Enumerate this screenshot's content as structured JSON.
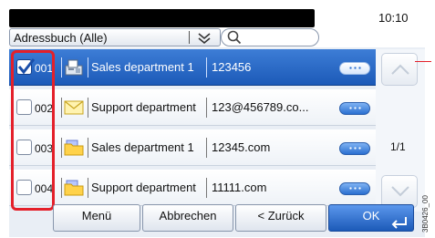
{
  "status": {
    "time": "10:10"
  },
  "addressbook": {
    "selector_label": "Adressbuch (Alle)",
    "search_placeholder": ""
  },
  "rows": [
    {
      "num": "001",
      "type": "fax",
      "name": "Sales department 1",
      "address": "123456",
      "selected": true
    },
    {
      "num": "002",
      "type": "email",
      "name": "Support department",
      "address": "123@456789.co...",
      "selected": false
    },
    {
      "num": "003",
      "type": "folder",
      "name": "Sales department 1",
      "address": "12345.com",
      "selected": false
    },
    {
      "num": "004",
      "type": "folder",
      "name": "Support department",
      "address": "11111.com",
      "selected": false
    }
  ],
  "pager": {
    "label": "1/1"
  },
  "buttons": {
    "menu": "Menü",
    "abort": "Abbrechen",
    "back": "< Zurück",
    "ok": "OK"
  },
  "doc_id": "3B0426_00"
}
